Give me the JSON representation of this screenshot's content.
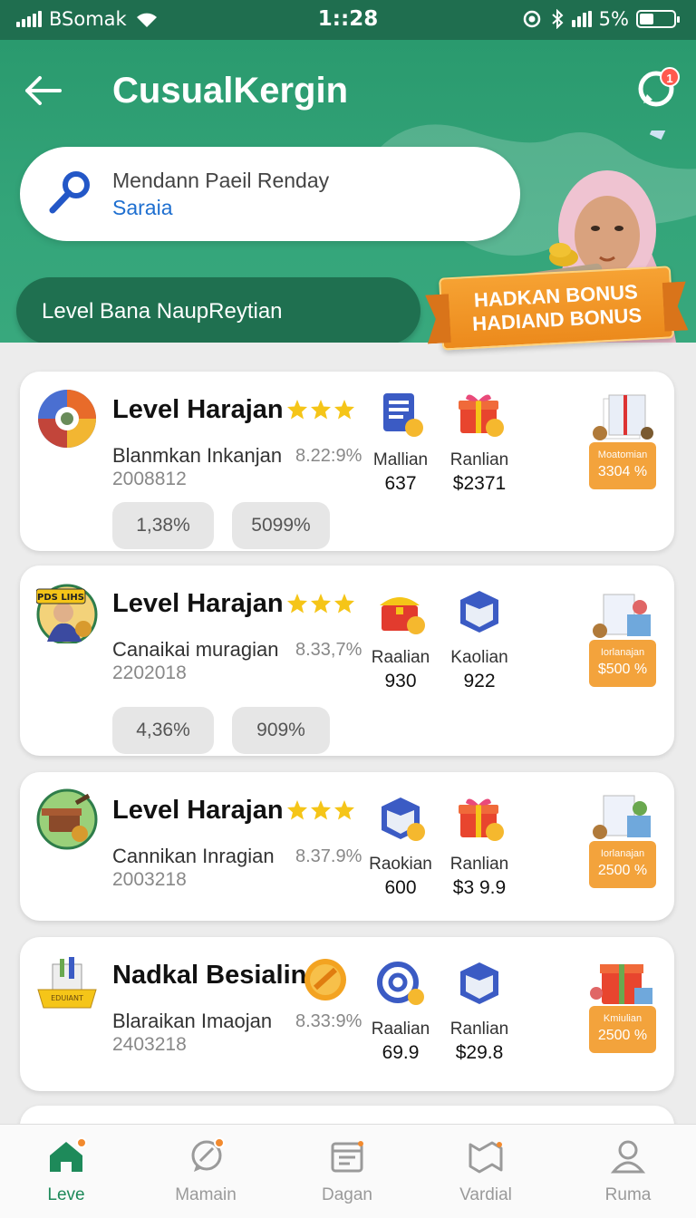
{
  "status_bar": {
    "carrier": "BSomak",
    "time": "1::28",
    "battery": "5%",
    "battery_level": 0.45
  },
  "header": {
    "title": "CusualKergin",
    "chat_badge": "1"
  },
  "search_card": {
    "line1": "Mendann Paeil Renday",
    "line2": "Saraia"
  },
  "level_pill": "Level Bana NaupReytian",
  "bonus_ribbon": {
    "line1": "HADKAN BONUS",
    "line2": "HADIAND BONUS"
  },
  "cards": [
    {
      "title": "Level Harajan",
      "stars": 3,
      "subtitle": "Blanmkan Inkanjan",
      "code": "2008812",
      "pct": "8.22:9%",
      "stats": [
        {
          "label": "Mallian",
          "value": "637",
          "icon": "document-coin-icon"
        },
        {
          "label": "Ranlian",
          "value": "$2371",
          "icon": "gift-coin-icon"
        }
      ],
      "reward": {
        "small": "Moatomian",
        "amount": "3304 %"
      },
      "chips": [
        "1,38%",
        "5099%"
      ]
    },
    {
      "title": "Level Harajan",
      "stars": 3,
      "subtitle": "Canaikai muragian",
      "code": "2202018",
      "pct": "8.33,7%",
      "stats": [
        {
          "label": "Raalian",
          "value": "930",
          "icon": "treasure-box-icon"
        },
        {
          "label": "Kaolian",
          "value": "922",
          "icon": "box-icon"
        }
      ],
      "reward": {
        "small": "Iorlanajan",
        "amount": "$500 %"
      },
      "chips": [
        "4,36%",
        "909%"
      ]
    },
    {
      "title": "Level Harajan",
      "stars": 3,
      "subtitle": "Cannikan Inragian",
      "code": "2003218",
      "pct": "8.37.9%",
      "stats": [
        {
          "label": "Raokian",
          "value": "600",
          "icon": "box-coin-icon"
        },
        {
          "label": "Ranlian",
          "value": "$3 9.9",
          "icon": "gift-coin-icon"
        }
      ],
      "reward": {
        "small": "Iorlanajan",
        "amount": "2500 %"
      }
    },
    {
      "title": "Nadkal Besialin",
      "subtitle": "Blaraikan Imaojan",
      "code": "2403218",
      "pct": "8.33:9%",
      "stats": [
        {
          "label": "Raalian",
          "value": "69.9",
          "icon": "target-coin-icon"
        },
        {
          "label": "Ranlian",
          "value": "$29.8",
          "icon": "box-icon"
        }
      ],
      "reward": {
        "small": "Kmiulian",
        "amount": "2500 %"
      }
    }
  ],
  "bottom_nav": [
    {
      "label": "Leve",
      "icon": "home-icon",
      "active": true
    },
    {
      "label": "Mamain",
      "icon": "chat-icon"
    },
    {
      "label": "Dagan",
      "icon": "calendar-icon"
    },
    {
      "label": "Vardial",
      "icon": "map-icon"
    },
    {
      "label": "Ruma",
      "icon": "profile-icon"
    }
  ],
  "colors": {
    "primary": "#2a9a6e",
    "dark_green": "#1f7050",
    "accent_orange": "#f3a33c",
    "link_blue": "#1e6fd0"
  }
}
